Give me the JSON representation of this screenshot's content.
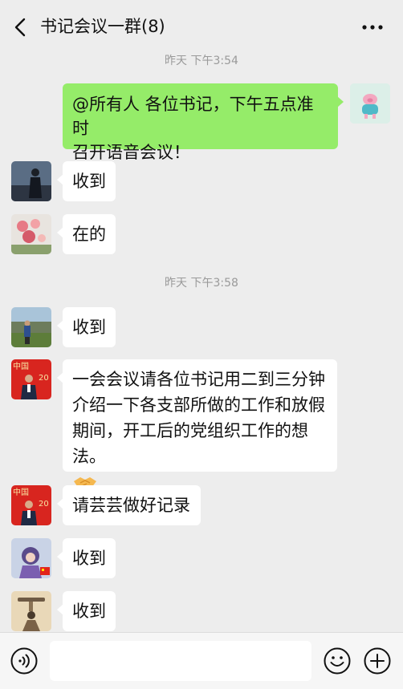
{
  "header": {
    "title": "书记会议一群(8)",
    "back_icon": "chevron-left-icon",
    "more_icon": "more-dots-icon"
  },
  "timestamps": [
    "昨天 下午3:54",
    "昨天 下午3:58"
  ],
  "messages": [
    {
      "side": "right",
      "text_line1": "@所有人  各位书记，下午五点准时",
      "text_line2": "召开语音会议！",
      "avatar": "pig-avatar"
    },
    {
      "side": "left",
      "text": "收到",
      "avatar": "dark-figure-avatar"
    },
    {
      "side": "left",
      "text": "在的",
      "avatar": "flowers-avatar"
    },
    {
      "side": "left",
      "text": "收到",
      "avatar": "man-field-avatar"
    },
    {
      "side": "left",
      "text_line1": "一会会议请各位书记用二到三分钟",
      "text_line2": "介绍一下各支部所做的工作和放假",
      "text_line3": "期间，开工后的党组织工作的想法。",
      "emoji": "handshake-emoji",
      "avatar": "man-red-banner-avatar"
    },
    {
      "side": "left",
      "text": "请芸芸做好记录",
      "avatar": "man-red-banner-avatar"
    },
    {
      "side": "left",
      "text": "收到",
      "avatar": "girl-flag-avatar"
    },
    {
      "side": "left",
      "text": "收到",
      "avatar": "rock-balance-avatar"
    }
  ],
  "input_bar": {
    "voice_icon": "voice-icon",
    "emoji_icon": "smiley-icon",
    "plus_icon": "plus-icon"
  },
  "colors": {
    "background": "#ededed",
    "my_bubble": "#95ec69",
    "other_bubble": "#ffffff",
    "timestamp": "#9a9a9a"
  }
}
